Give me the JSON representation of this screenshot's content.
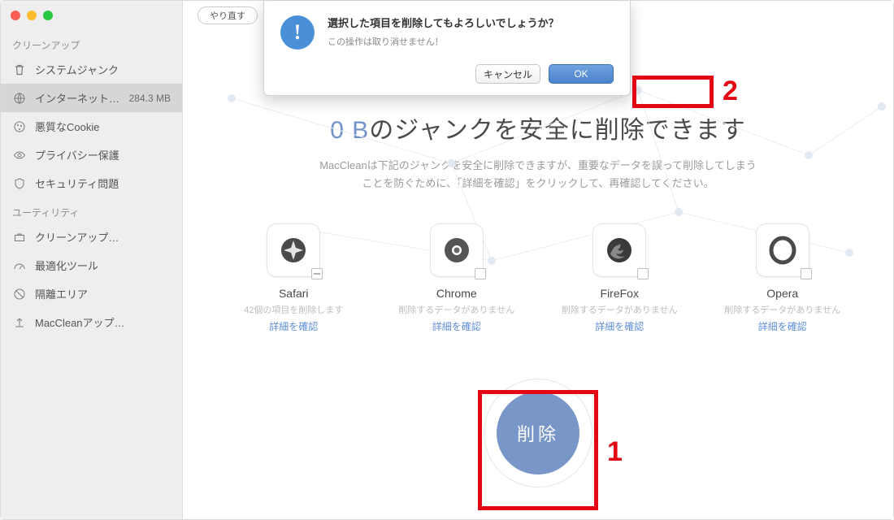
{
  "header": {
    "redo_label": "やり直す"
  },
  "sidebar": {
    "section_cleanup": "クリーンアップ",
    "section_utility": "ユーティリティ",
    "items": [
      {
        "label": "システムジャンク"
      },
      {
        "label": "インターネット…",
        "meta": "284.3 MB"
      },
      {
        "label": "悪質なCookie"
      },
      {
        "label": "プライバシー保護"
      },
      {
        "label": "セキュリティ問題"
      }
    ],
    "utilities": [
      {
        "label": "クリーンアップ…"
      },
      {
        "label": "最適化ツール"
      },
      {
        "label": "隔離エリア"
      },
      {
        "label": "MacCleanアップ…"
      }
    ]
  },
  "main": {
    "headline_size": "0 B",
    "headline_rest": "のジャンクを安全に削除できます",
    "sub1": "MacCleanは下記のジャンクを安全に削除できますが、重要なデータを誤って削除してしまう",
    "sub2": "ことを防ぐために、「詳細を確認」をクリックして、再確認してください。",
    "delete_label": "削除",
    "browsers": [
      {
        "name": "Safari",
        "desc": "42個の項目を削除します",
        "link": "詳細を確認"
      },
      {
        "name": "Chrome",
        "desc": "削除するデータがありません",
        "link": "詳細を確認"
      },
      {
        "name": "FireFox",
        "desc": "削除するデータがありません",
        "link": "詳細を確認"
      },
      {
        "name": "Opera",
        "desc": "削除するデータがありません",
        "link": "詳細を確認"
      }
    ]
  },
  "dialog": {
    "title": "選択した項目を削除してもよろしいでしょうか？",
    "sub": "この操作は取り消せません！",
    "cancel": "キャンセル",
    "ok": "OK"
  },
  "annotations": {
    "step1": "1",
    "step2": "2"
  }
}
